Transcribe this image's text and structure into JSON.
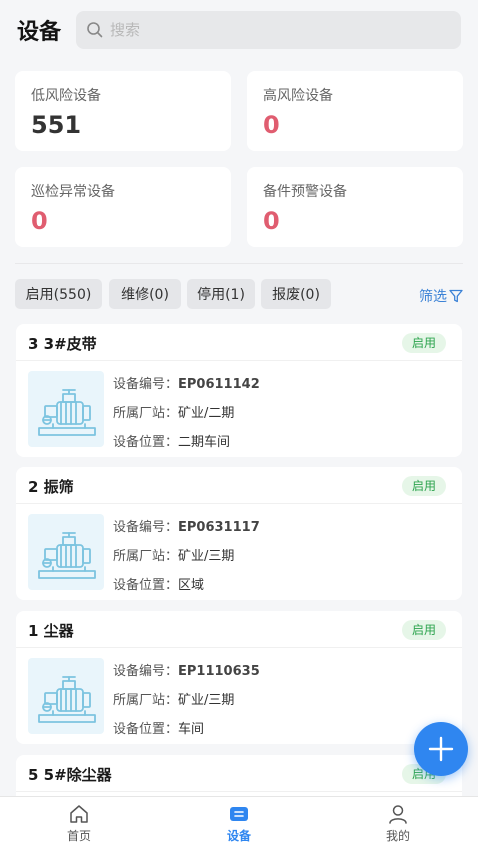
{
  "header": {
    "title": "设备",
    "search_placeholder": "搜索"
  },
  "stats": [
    {
      "label": "低风险设备",
      "value": "551",
      "color": "#333333"
    },
    {
      "label": "高风险设备",
      "value": "0",
      "color": "#e05d70"
    },
    {
      "label": "巡检异常设备",
      "value": "0",
      "color": "#e05d70"
    },
    {
      "label": "备件预警设备",
      "value": "0",
      "color": "#e05d70"
    }
  ],
  "chips": [
    "启用(550)",
    "维修(0)",
    "停用(1)",
    "报废(0)"
  ],
  "filter_label": "筛选",
  "field_labels": {
    "code": "设备编号：",
    "station": "所属厂站：",
    "location": "设备位置："
  },
  "devices": [
    {
      "title": "3 3#皮带",
      "status": "启用",
      "code": "EP0611142",
      "station": "矿业/二期",
      "location": "二期车间"
    },
    {
      "title": "2 振筛",
      "status": "启用",
      "code": "EP0631117",
      "station": "矿业/三期",
      "location": "区域"
    },
    {
      "title": "1 尘器",
      "status": "启用",
      "code": "EP1110635",
      "station": "矿业/三期",
      "location": "车间"
    },
    {
      "title": "5 5#除尘器",
      "status": "启用"
    }
  ],
  "tabs": [
    {
      "label": "首页",
      "icon": "home-icon"
    },
    {
      "label": "设备",
      "icon": "device-icon"
    },
    {
      "label": "我的",
      "icon": "user-icon"
    }
  ],
  "colors": {
    "accent": "#2f86f0",
    "danger": "#e05d70",
    "status_green": "#2da44e"
  }
}
